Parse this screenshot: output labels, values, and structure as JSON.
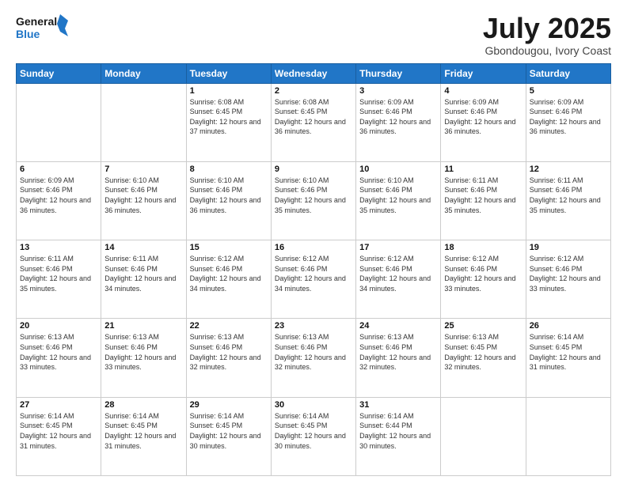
{
  "logo": {
    "line1": "General",
    "line2": "Blue"
  },
  "header": {
    "month": "July 2025",
    "location": "Gbondougou, Ivory Coast"
  },
  "days_of_week": [
    "Sunday",
    "Monday",
    "Tuesday",
    "Wednesday",
    "Thursday",
    "Friday",
    "Saturday"
  ],
  "weeks": [
    [
      {
        "day": "",
        "sunrise": "",
        "sunset": "",
        "daylight": ""
      },
      {
        "day": "",
        "sunrise": "",
        "sunset": "",
        "daylight": ""
      },
      {
        "day": "1",
        "sunrise": "Sunrise: 6:08 AM",
        "sunset": "Sunset: 6:45 PM",
        "daylight": "Daylight: 12 hours and 37 minutes."
      },
      {
        "day": "2",
        "sunrise": "Sunrise: 6:08 AM",
        "sunset": "Sunset: 6:45 PM",
        "daylight": "Daylight: 12 hours and 36 minutes."
      },
      {
        "day": "3",
        "sunrise": "Sunrise: 6:09 AM",
        "sunset": "Sunset: 6:46 PM",
        "daylight": "Daylight: 12 hours and 36 minutes."
      },
      {
        "day": "4",
        "sunrise": "Sunrise: 6:09 AM",
        "sunset": "Sunset: 6:46 PM",
        "daylight": "Daylight: 12 hours and 36 minutes."
      },
      {
        "day": "5",
        "sunrise": "Sunrise: 6:09 AM",
        "sunset": "Sunset: 6:46 PM",
        "daylight": "Daylight: 12 hours and 36 minutes."
      }
    ],
    [
      {
        "day": "6",
        "sunrise": "Sunrise: 6:09 AM",
        "sunset": "Sunset: 6:46 PM",
        "daylight": "Daylight: 12 hours and 36 minutes."
      },
      {
        "day": "7",
        "sunrise": "Sunrise: 6:10 AM",
        "sunset": "Sunset: 6:46 PM",
        "daylight": "Daylight: 12 hours and 36 minutes."
      },
      {
        "day": "8",
        "sunrise": "Sunrise: 6:10 AM",
        "sunset": "Sunset: 6:46 PM",
        "daylight": "Daylight: 12 hours and 36 minutes."
      },
      {
        "day": "9",
        "sunrise": "Sunrise: 6:10 AM",
        "sunset": "Sunset: 6:46 PM",
        "daylight": "Daylight: 12 hours and 35 minutes."
      },
      {
        "day": "10",
        "sunrise": "Sunrise: 6:10 AM",
        "sunset": "Sunset: 6:46 PM",
        "daylight": "Daylight: 12 hours and 35 minutes."
      },
      {
        "day": "11",
        "sunrise": "Sunrise: 6:11 AM",
        "sunset": "Sunset: 6:46 PM",
        "daylight": "Daylight: 12 hours and 35 minutes."
      },
      {
        "day": "12",
        "sunrise": "Sunrise: 6:11 AM",
        "sunset": "Sunset: 6:46 PM",
        "daylight": "Daylight: 12 hours and 35 minutes."
      }
    ],
    [
      {
        "day": "13",
        "sunrise": "Sunrise: 6:11 AM",
        "sunset": "Sunset: 6:46 PM",
        "daylight": "Daylight: 12 hours and 35 minutes."
      },
      {
        "day": "14",
        "sunrise": "Sunrise: 6:11 AM",
        "sunset": "Sunset: 6:46 PM",
        "daylight": "Daylight: 12 hours and 34 minutes."
      },
      {
        "day": "15",
        "sunrise": "Sunrise: 6:12 AM",
        "sunset": "Sunset: 6:46 PM",
        "daylight": "Daylight: 12 hours and 34 minutes."
      },
      {
        "day": "16",
        "sunrise": "Sunrise: 6:12 AM",
        "sunset": "Sunset: 6:46 PM",
        "daylight": "Daylight: 12 hours and 34 minutes."
      },
      {
        "day": "17",
        "sunrise": "Sunrise: 6:12 AM",
        "sunset": "Sunset: 6:46 PM",
        "daylight": "Daylight: 12 hours and 34 minutes."
      },
      {
        "day": "18",
        "sunrise": "Sunrise: 6:12 AM",
        "sunset": "Sunset: 6:46 PM",
        "daylight": "Daylight: 12 hours and 33 minutes."
      },
      {
        "day": "19",
        "sunrise": "Sunrise: 6:12 AM",
        "sunset": "Sunset: 6:46 PM",
        "daylight": "Daylight: 12 hours and 33 minutes."
      }
    ],
    [
      {
        "day": "20",
        "sunrise": "Sunrise: 6:13 AM",
        "sunset": "Sunset: 6:46 PM",
        "daylight": "Daylight: 12 hours and 33 minutes."
      },
      {
        "day": "21",
        "sunrise": "Sunrise: 6:13 AM",
        "sunset": "Sunset: 6:46 PM",
        "daylight": "Daylight: 12 hours and 33 minutes."
      },
      {
        "day": "22",
        "sunrise": "Sunrise: 6:13 AM",
        "sunset": "Sunset: 6:46 PM",
        "daylight": "Daylight: 12 hours and 32 minutes."
      },
      {
        "day": "23",
        "sunrise": "Sunrise: 6:13 AM",
        "sunset": "Sunset: 6:46 PM",
        "daylight": "Daylight: 12 hours and 32 minutes."
      },
      {
        "day": "24",
        "sunrise": "Sunrise: 6:13 AM",
        "sunset": "Sunset: 6:46 PM",
        "daylight": "Daylight: 12 hours and 32 minutes."
      },
      {
        "day": "25",
        "sunrise": "Sunrise: 6:13 AM",
        "sunset": "Sunset: 6:45 PM",
        "daylight": "Daylight: 12 hours and 32 minutes."
      },
      {
        "day": "26",
        "sunrise": "Sunrise: 6:14 AM",
        "sunset": "Sunset: 6:45 PM",
        "daylight": "Daylight: 12 hours and 31 minutes."
      }
    ],
    [
      {
        "day": "27",
        "sunrise": "Sunrise: 6:14 AM",
        "sunset": "Sunset: 6:45 PM",
        "daylight": "Daylight: 12 hours and 31 minutes."
      },
      {
        "day": "28",
        "sunrise": "Sunrise: 6:14 AM",
        "sunset": "Sunset: 6:45 PM",
        "daylight": "Daylight: 12 hours and 31 minutes."
      },
      {
        "day": "29",
        "sunrise": "Sunrise: 6:14 AM",
        "sunset": "Sunset: 6:45 PM",
        "daylight": "Daylight: 12 hours and 30 minutes."
      },
      {
        "day": "30",
        "sunrise": "Sunrise: 6:14 AM",
        "sunset": "Sunset: 6:45 PM",
        "daylight": "Daylight: 12 hours and 30 minutes."
      },
      {
        "day": "31",
        "sunrise": "Sunrise: 6:14 AM",
        "sunset": "Sunset: 6:44 PM",
        "daylight": "Daylight: 12 hours and 30 minutes."
      },
      {
        "day": "",
        "sunrise": "",
        "sunset": "",
        "daylight": ""
      },
      {
        "day": "",
        "sunrise": "",
        "sunset": "",
        "daylight": ""
      }
    ]
  ]
}
